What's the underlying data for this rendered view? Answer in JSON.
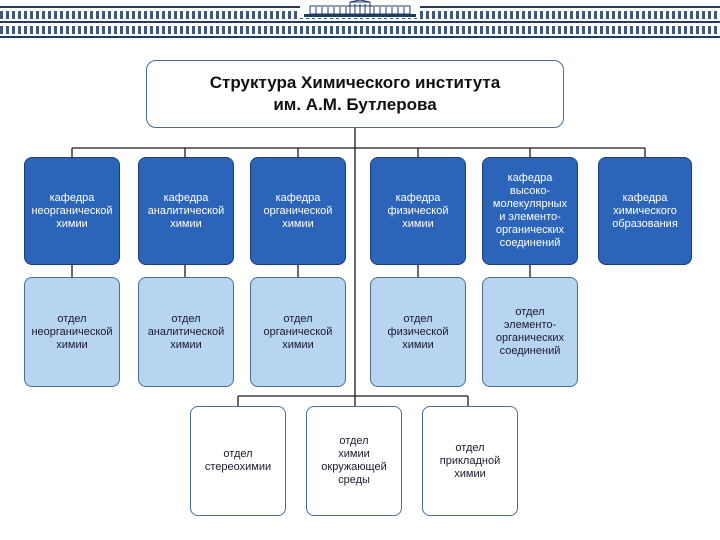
{
  "title": {
    "line1": "Структура Химического института",
    "line2": "им. А.М. Бутлерова"
  },
  "departments": [
    "кафедра\nнеорганической\nхимии",
    "кафедра\nаналитической\nхимии",
    "кафедра\nорганической\nхимии",
    "кафедра\nфизической\nхимии",
    "кафедра\nвысоко-\nмолекулярных\nи элементо-\nорганических\nсоединений",
    "кафедра\nхимического\nобразования"
  ],
  "divisions": [
    "отдел\nнеорганической\nхимии",
    "отдел\nаналитической\nхимии",
    "отдел\nорганической\nхимии",
    "отдел\nфизической\nхимии",
    "отдел\nэлементо-\nорганических\nсоединений"
  ],
  "sub_divisions": [
    "отдел\nстереохимии",
    "отдел\nхимии\nокружающей\nсреды",
    "отдел\nприкладной\nхимии"
  ],
  "colors": {
    "department_fill": "#2b64b8",
    "division_fill": "#b7d4f0",
    "border": "#4a6e98",
    "header_band": "#1f3a63"
  }
}
